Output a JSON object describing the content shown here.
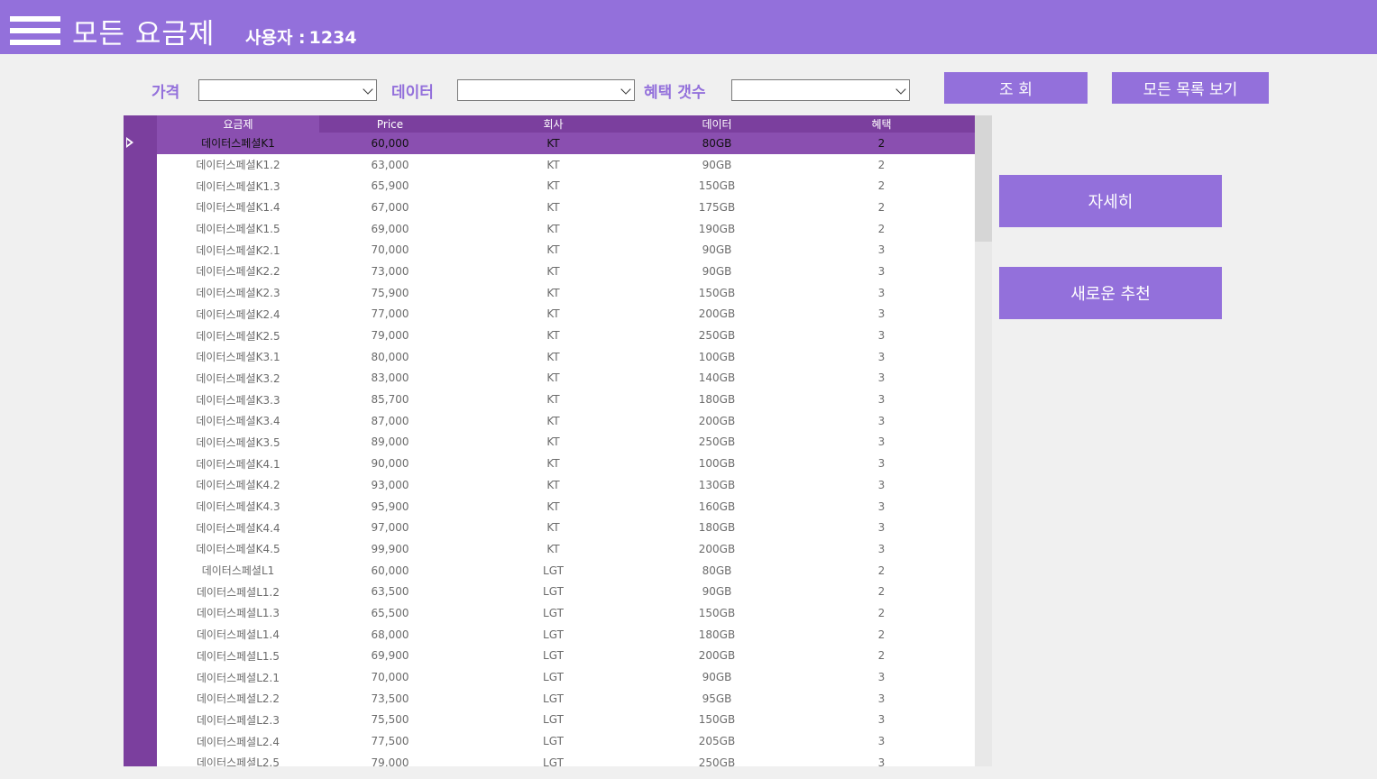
{
  "header": {
    "title": "모든 요금제",
    "user_label": "사용자 :",
    "user_id": "1234"
  },
  "filters": [
    {
      "label": "가격",
      "value": ""
    },
    {
      "label": "데이터",
      "value": ""
    },
    {
      "label": "혜택 갯수",
      "value": ""
    }
  ],
  "buttons": {
    "search": "조 회",
    "show_all": "모든 목록 보기",
    "details": "자세히",
    "recommend": "새로운 추천"
  },
  "table": {
    "columns": [
      "요금제",
      "Price",
      "회사",
      "데이터",
      "혜택"
    ],
    "selected_row": 0,
    "rows": [
      [
        "데이터스페셜K1",
        "60,000",
        "KT",
        "80GB",
        "2"
      ],
      [
        "데이터스페셜K1.2",
        "63,000",
        "KT",
        "90GB",
        "2"
      ],
      [
        "데이터스페셜K1.3",
        "65,900",
        "KT",
        "150GB",
        "2"
      ],
      [
        "데이터스페셜K1.4",
        "67,000",
        "KT",
        "175GB",
        "2"
      ],
      [
        "데이터스페셜K1.5",
        "69,000",
        "KT",
        "190GB",
        "2"
      ],
      [
        "데이터스페셜K2.1",
        "70,000",
        "KT",
        "90GB",
        "3"
      ],
      [
        "데이터스페셜K2.2",
        "73,000",
        "KT",
        "90GB",
        "3"
      ],
      [
        "데이터스페셜K2.3",
        "75,900",
        "KT",
        "150GB",
        "3"
      ],
      [
        "데이터스페셜K2.4",
        "77,000",
        "KT",
        "200GB",
        "3"
      ],
      [
        "데이터스페셜K2.5",
        "79,000",
        "KT",
        "250GB",
        "3"
      ],
      [
        "데이터스페셜K3.1",
        "80,000",
        "KT",
        "100GB",
        "3"
      ],
      [
        "데이터스페셜K3.2",
        "83,000",
        "KT",
        "140GB",
        "3"
      ],
      [
        "데이터스페셜K3.3",
        "85,700",
        "KT",
        "180GB",
        "3"
      ],
      [
        "데이터스페셜K3.4",
        "87,000",
        "KT",
        "200GB",
        "3"
      ],
      [
        "데이터스페셜K3.5",
        "89,000",
        "KT",
        "250GB",
        "3"
      ],
      [
        "데이터스페셜K4.1",
        "90,000",
        "KT",
        "100GB",
        "3"
      ],
      [
        "데이터스페셜K4.2",
        "93,000",
        "KT",
        "130GB",
        "3"
      ],
      [
        "데이터스페셜K4.3",
        "95,900",
        "KT",
        "160GB",
        "3"
      ],
      [
        "데이터스페셜K4.4",
        "97,000",
        "KT",
        "180GB",
        "3"
      ],
      [
        "데이터스페셜K4.5",
        "99,900",
        "KT",
        "200GB",
        "3"
      ],
      [
        "데이터스페셜L1",
        "60,000",
        "LGT",
        "80GB",
        "2"
      ],
      [
        "데이터스페셜L1.2",
        "63,500",
        "LGT",
        "90GB",
        "2"
      ],
      [
        "데이터스페셜L1.3",
        "65,500",
        "LGT",
        "150GB",
        "2"
      ],
      [
        "데이터스페셜L1.4",
        "68,000",
        "LGT",
        "180GB",
        "2"
      ],
      [
        "데이터스페셜L1.5",
        "69,900",
        "LGT",
        "200GB",
        "2"
      ],
      [
        "데이터스페셜L2.1",
        "70,000",
        "LGT",
        "90GB",
        "3"
      ],
      [
        "데이터스페셜L2.2",
        "73,500",
        "LGT",
        "95GB",
        "3"
      ],
      [
        "데이터스페셜L2.3",
        "75,500",
        "LGT",
        "150GB",
        "3"
      ],
      [
        "데이터스페셜L2.4",
        "77,500",
        "LGT",
        "205GB",
        "3"
      ],
      [
        "데이터스페셜L2.5",
        "79,000",
        "LGT",
        "250GB",
        "3"
      ]
    ]
  },
  "colors": {
    "accent": "#9370db",
    "grid_header": "#7b3f9e",
    "selected_row": "#8a4fb0"
  },
  "icons": {
    "menu": "hamburger-menu-icon",
    "row_pointer": "current-row-arrow-icon",
    "dropdown": "chevron-down-icon"
  }
}
